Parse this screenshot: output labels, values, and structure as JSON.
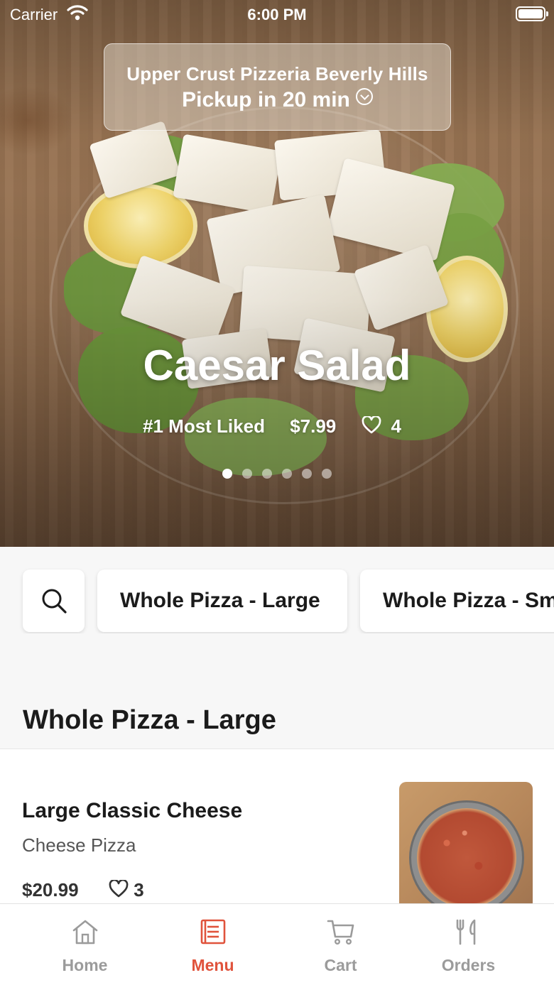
{
  "status_bar": {
    "carrier": "Carrier",
    "time": "6:00 PM"
  },
  "location": {
    "restaurant": "Upper Crust Pizzeria Beverly Hills",
    "pickup": "Pickup in 20 min"
  },
  "featured": {
    "title": "Caesar Salad",
    "rank": "#1 Most Liked",
    "price": "$7.99",
    "likes": "4",
    "slides": 6,
    "active_slide": 1
  },
  "categories": {
    "search_icon": "search-icon",
    "items": [
      "Whole Pizza - Large",
      "Whole Pizza - Sm"
    ]
  },
  "section": {
    "title": "Whole Pizza - Large"
  },
  "menu_item": {
    "name": "Large Classic Cheese",
    "description": "Cheese Pizza",
    "price": "$20.99",
    "likes": "3"
  },
  "tabs": [
    {
      "label": "Home",
      "icon": "home-icon"
    },
    {
      "label": "Menu",
      "icon": "menu-icon"
    },
    {
      "label": "Cart",
      "icon": "cart-icon"
    },
    {
      "label": "Orders",
      "icon": "orders-icon"
    }
  ],
  "colors": {
    "accent": "#e0533c",
    "inactive": "#9b9b9b"
  }
}
